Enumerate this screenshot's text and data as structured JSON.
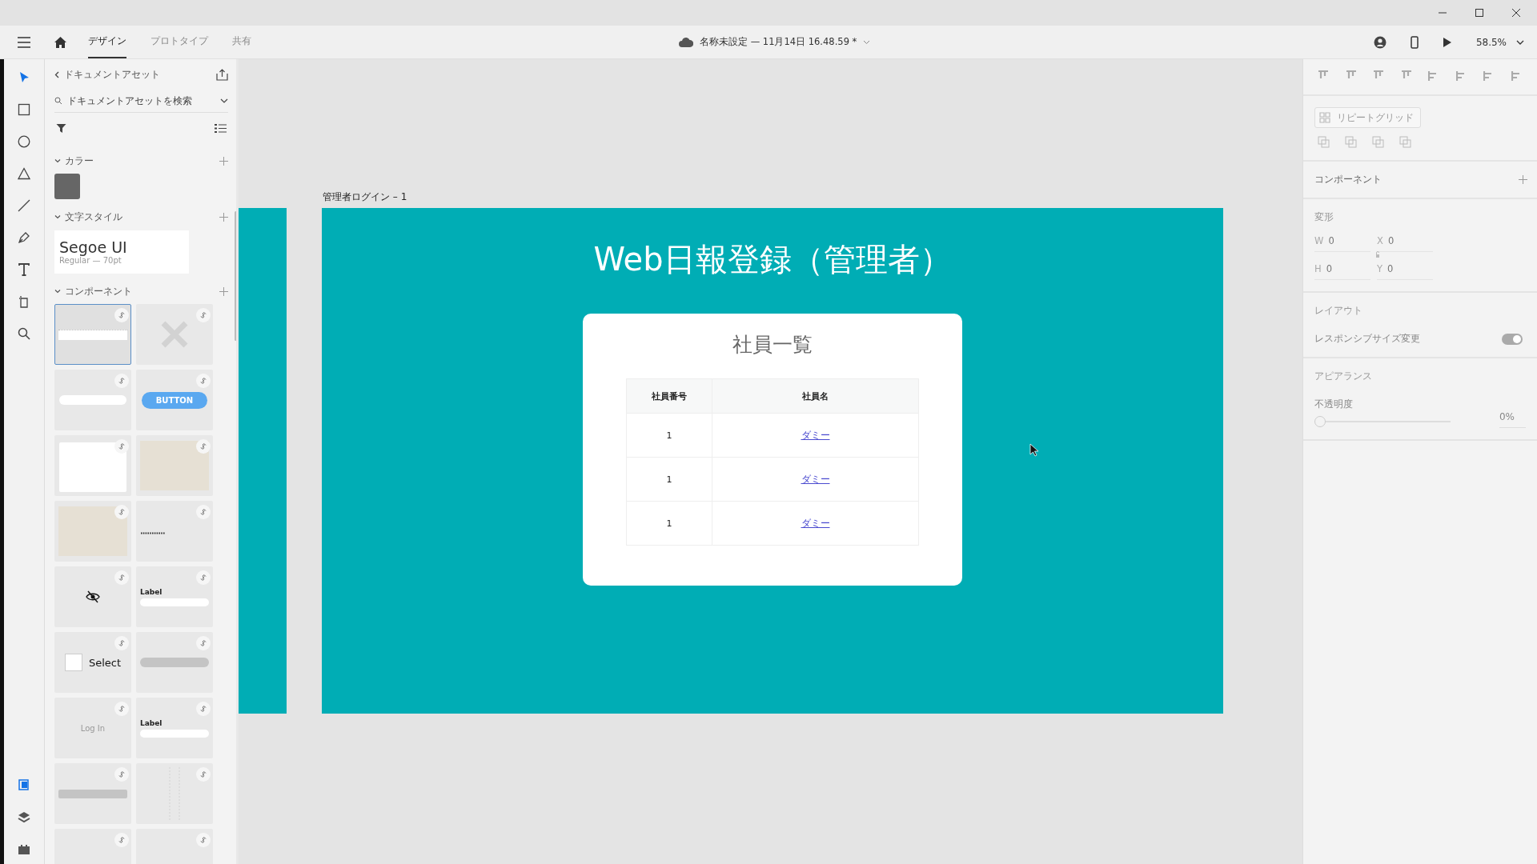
{
  "toolbar": {
    "tabs": [
      {
        "label": "デザイン",
        "selected": true
      },
      {
        "label": "プロトタイプ",
        "selected": false
      },
      {
        "label": "共有",
        "selected": false
      }
    ],
    "document_title": "名称未設定 — 11月14日 16.48.59 *",
    "zoom": "58.5%"
  },
  "tools": [
    {
      "kind": "select",
      "selected": true
    },
    {
      "kind": "rectangle",
      "selected": false
    },
    {
      "kind": "ellipse",
      "selected": false
    },
    {
      "kind": "polygon",
      "selected": false
    },
    {
      "kind": "line",
      "selected": false
    },
    {
      "kind": "pen",
      "selected": false
    },
    {
      "kind": "text",
      "selected": false
    },
    {
      "kind": "artboard",
      "selected": false
    },
    {
      "kind": "zoom",
      "selected": false
    }
  ],
  "rail_bottom": [
    {
      "kind": "assets",
      "selected": true
    },
    {
      "kind": "layers",
      "selected": false
    },
    {
      "kind": "plugins",
      "selected": false
    }
  ],
  "assets_panel": {
    "title": "ドキュメントアセット",
    "search": {
      "placeholder": "ドキュメントアセットを検索"
    },
    "colors": {
      "title": "カラー",
      "expanded": true,
      "swatches": [
        {
          "color": "#666666"
        }
      ]
    },
    "text_styles": {
      "title": "文字スタイル",
      "expanded": true,
      "styles": [
        {
          "font": "Segoe UI",
          "detail": "Regular — 70pt"
        }
      ]
    },
    "components": {
      "title": "コンポーネント",
      "expanded": true,
      "tiles": [
        {
          "kind": "table",
          "selected": true
        },
        {
          "kind": "missing",
          "selected": false
        },
        {
          "kind": "input",
          "selected": false
        },
        {
          "kind": "button",
          "selected": false,
          "text": "BUTTON"
        },
        {
          "kind": "card",
          "selected": false
        },
        {
          "kind": "photo",
          "selected": false
        },
        {
          "kind": "photo",
          "selected": false
        },
        {
          "kind": "password",
          "selected": false
        },
        {
          "kind": "eye-off",
          "selected": false
        },
        {
          "kind": "labeled-input",
          "selected": false,
          "text": "Label"
        },
        {
          "kind": "checkbox",
          "selected": false,
          "text": "Select"
        },
        {
          "kind": "pill",
          "selected": false
        },
        {
          "kind": "text",
          "selected": false,
          "text": "Log In"
        },
        {
          "kind": "labeled-input",
          "selected": false,
          "text": "Label"
        },
        {
          "kind": "bar",
          "selected": false
        },
        {
          "kind": "column",
          "selected": false
        },
        {
          "kind": "blank",
          "selected": false
        },
        {
          "kind": "blank",
          "selected": false
        }
      ]
    }
  },
  "canvas": {
    "artboard_label": "管理者ログイン – 1",
    "title": "Web日報登録（管理者）",
    "card": {
      "title": "社員一覧",
      "table": {
        "columns": [
          "社員番号",
          "社員名"
        ],
        "rows": [
          [
            "1",
            "ダミー"
          ],
          [
            "1",
            "ダミー"
          ],
          [
            "1",
            "ダミー"
          ]
        ]
      }
    }
  },
  "properties_panel": {
    "repeat_grid": "リピートグリッド",
    "component_label": "コンポーネント",
    "transform": {
      "title": "変形",
      "fields": [
        {
          "label": "W",
          "value": "0"
        },
        {
          "label": "X",
          "value": "0"
        },
        {
          "label": "H",
          "value": "0"
        },
        {
          "label": "Y",
          "value": "0"
        }
      ]
    },
    "layout": {
      "title": "レイアウト",
      "responsive": {
        "label": "レスポンシブサイズ変更",
        "on": true
      }
    },
    "appearance": {
      "title": "アピアランス",
      "opacity": {
        "label": "不透明度",
        "level": 0,
        "reading": "0%"
      }
    }
  }
}
